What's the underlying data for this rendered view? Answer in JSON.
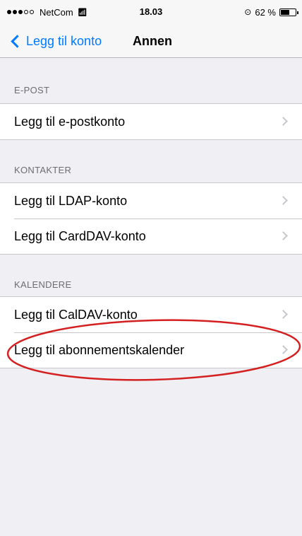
{
  "status_bar": {
    "carrier": "NetCom",
    "signal_bars_filled": 3,
    "signal_bars_total": 5,
    "time": "18.03",
    "battery_percent": "62 %",
    "battery_level": 0.62
  },
  "navbar": {
    "back_label": "Legg til konto",
    "title": "Annen"
  },
  "sections": {
    "epost": {
      "header": "E-POST",
      "rows": [
        "Legg til e-postkonto"
      ]
    },
    "kontakter": {
      "header": "KONTAKTER",
      "rows": [
        "Legg til LDAP-konto",
        "Legg til CardDAV-konto"
      ]
    },
    "kalendere": {
      "header": "KALENDERE",
      "rows": [
        "Legg til CalDAV-konto",
        "Legg til abonnementskalender"
      ]
    }
  },
  "colors": {
    "accent": "#007aff",
    "annotation": "#d42020",
    "background": "#efeff4"
  },
  "icons": {
    "back": "chevron-left-icon",
    "disclosure": "chevron-right-icon",
    "wifi": "wifi-icon",
    "orientation_lock": "orientation-lock-icon",
    "battery": "battery-icon"
  }
}
